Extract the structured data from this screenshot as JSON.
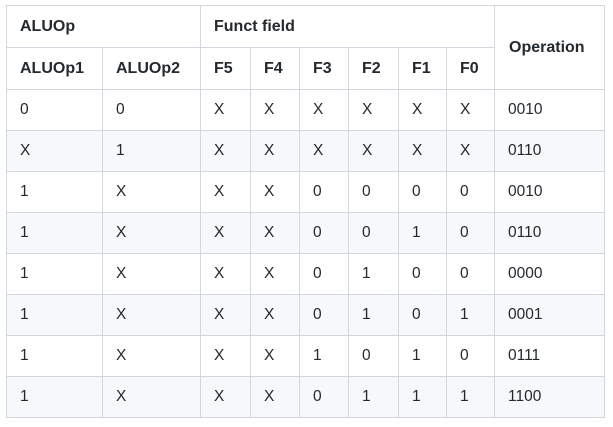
{
  "header": {
    "group_aluop": "ALUOp",
    "group_funct": "Funct field",
    "operation": "Operation",
    "columns": [
      "ALUOp1",
      "ALUOp2",
      "F5",
      "F4",
      "F3",
      "F2",
      "F1",
      "F0"
    ]
  },
  "rows": [
    [
      "0",
      "0",
      "X",
      "X",
      "X",
      "X",
      "X",
      "X",
      "0010"
    ],
    [
      "X",
      "1",
      "X",
      "X",
      "X",
      "X",
      "X",
      "X",
      "0110"
    ],
    [
      "1",
      "X",
      "X",
      "X",
      "0",
      "0",
      "0",
      "0",
      "0010"
    ],
    [
      "1",
      "X",
      "X",
      "X",
      "0",
      "0",
      "1",
      "0",
      "0110"
    ],
    [
      "1",
      "X",
      "X",
      "X",
      "0",
      "1",
      "0",
      "0",
      "0000"
    ],
    [
      "1",
      "X",
      "X",
      "X",
      "0",
      "1",
      "0",
      "1",
      "0001"
    ],
    [
      "1",
      "X",
      "X",
      "X",
      "1",
      "0",
      "1",
      "0",
      "0111"
    ],
    [
      "1",
      "X",
      "X",
      "X",
      "0",
      "1",
      "1",
      "1",
      "1100"
    ]
  ]
}
